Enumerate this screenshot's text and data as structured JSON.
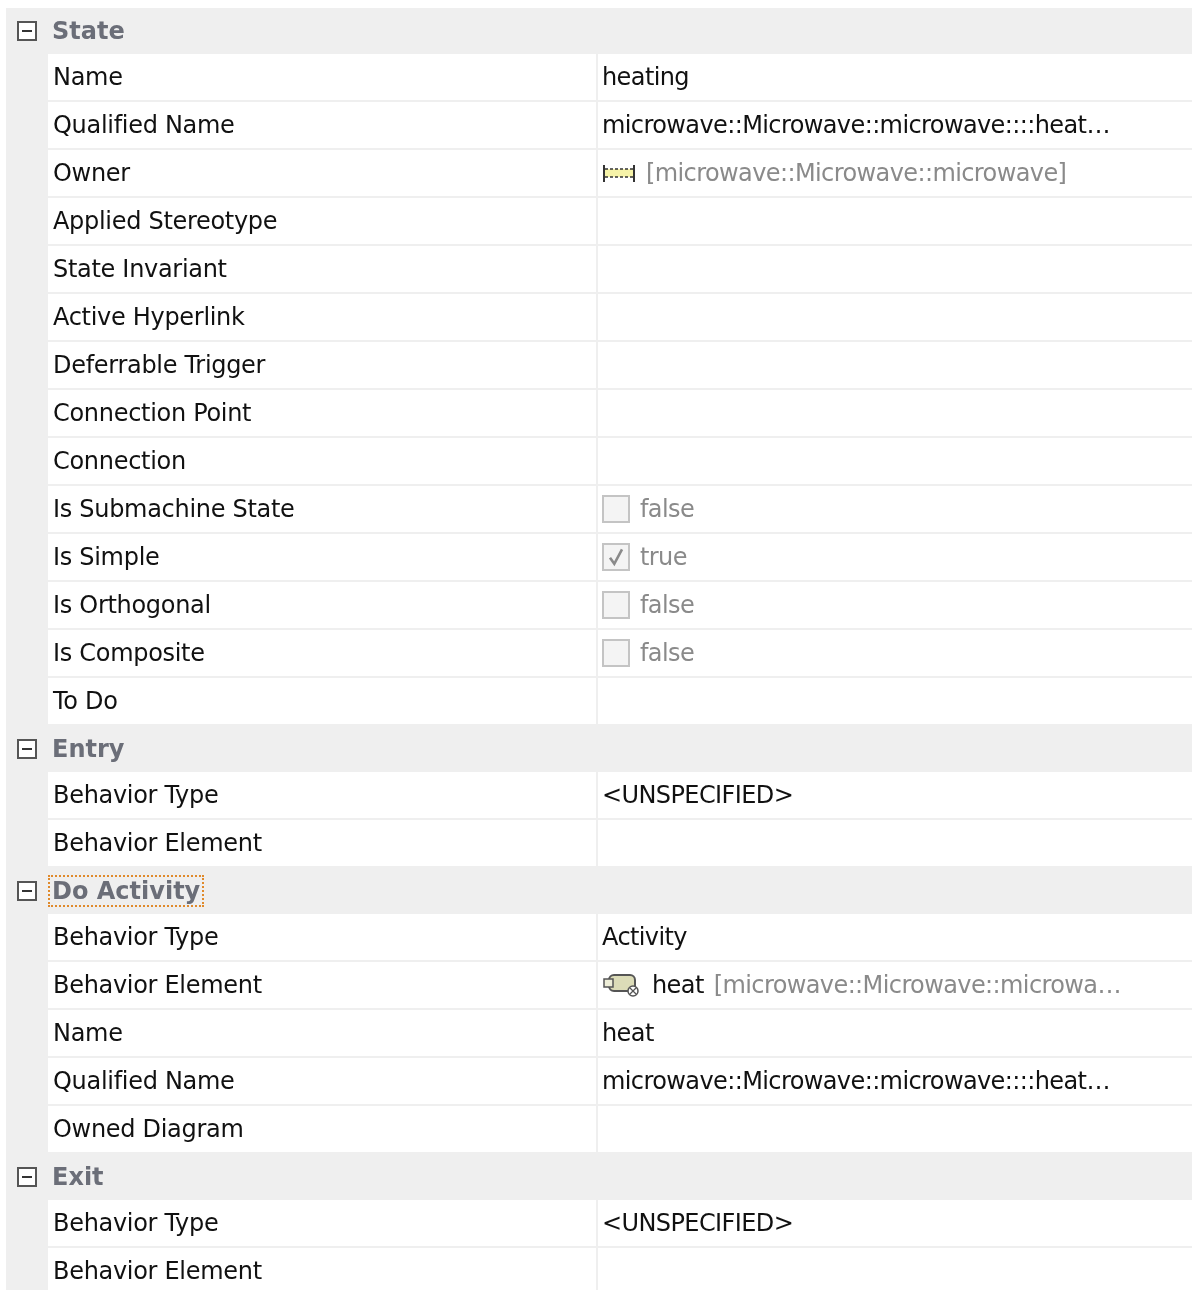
{
  "sections": [
    {
      "title": "State",
      "expanded": true,
      "focused": false,
      "rows": [
        {
          "label": "Name",
          "value": {
            "kind": "text",
            "text": "heating"
          }
        },
        {
          "label": "Qualified Name",
          "value": {
            "kind": "text",
            "text": "microwave::Microwave::microwave::::heat…"
          }
        },
        {
          "label": "Owner",
          "value": {
            "kind": "owner",
            "path": "[microwave::Microwave::microwave]"
          }
        },
        {
          "label": "Applied Stereotype"
        },
        {
          "label": "State Invariant"
        },
        {
          "label": "Active Hyperlink"
        },
        {
          "label": "Deferrable Trigger"
        },
        {
          "label": "Connection Point"
        },
        {
          "label": "Connection"
        },
        {
          "label": "Is Submachine State",
          "value": {
            "kind": "checkbox",
            "checked": false,
            "text": "false"
          }
        },
        {
          "label": "Is Simple",
          "value": {
            "kind": "checkbox",
            "checked": true,
            "text": "true"
          }
        },
        {
          "label": "Is Orthogonal",
          "value": {
            "kind": "checkbox",
            "checked": false,
            "text": "false"
          }
        },
        {
          "label": "Is Composite",
          "value": {
            "kind": "checkbox",
            "checked": false,
            "text": "false"
          }
        },
        {
          "label": "To Do"
        }
      ]
    },
    {
      "title": "Entry",
      "expanded": true,
      "focused": false,
      "rows": [
        {
          "label": "Behavior Type",
          "value": {
            "kind": "text",
            "text": "<UNSPECIFIED>"
          }
        },
        {
          "label": "Behavior Element"
        }
      ]
    },
    {
      "title": "Do Activity",
      "expanded": true,
      "focused": true,
      "rows": [
        {
          "label": "Behavior Type",
          "value": {
            "kind": "text",
            "text": "Activity"
          }
        },
        {
          "label": "Behavior Element",
          "value": {
            "kind": "element",
            "name": "heat",
            "path": "[microwave::Microwave::microwa…"
          }
        },
        {
          "label": "Name",
          "value": {
            "kind": "text",
            "text": "heat"
          }
        },
        {
          "label": "Qualified Name",
          "value": {
            "kind": "text",
            "text": "microwave::Microwave::microwave::::heat…"
          }
        },
        {
          "label": "Owned Diagram"
        }
      ]
    },
    {
      "title": "Exit",
      "expanded": true,
      "focused": false,
      "rows": [
        {
          "label": "Behavior Type",
          "value": {
            "kind": "text",
            "text": "<UNSPECIFIED>"
          }
        },
        {
          "label": "Behavior Element"
        }
      ]
    }
  ]
}
